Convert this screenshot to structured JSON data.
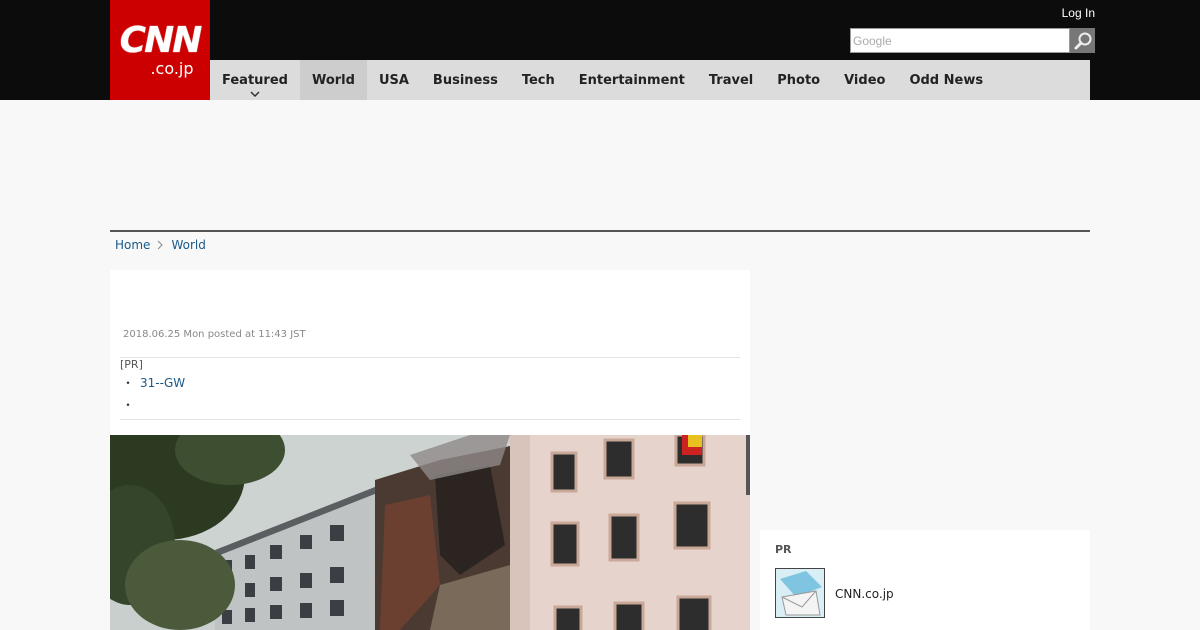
{
  "header": {
    "logo_main": "CNN",
    "logo_sub": ".co.jp",
    "login_label": "Log In",
    "search_placeholder": "Google"
  },
  "nav": {
    "items": [
      {
        "label": "Featured"
      },
      {
        "label": "World"
      },
      {
        "label": "USA"
      },
      {
        "label": "Business"
      },
      {
        "label": "Tech"
      },
      {
        "label": "Entertainment"
      },
      {
        "label": "Travel"
      },
      {
        "label": "Photo"
      },
      {
        "label": "Video"
      },
      {
        "label": "Odd News"
      }
    ],
    "active": "World"
  },
  "breadcrumb": {
    "home": "Home",
    "section": "World"
  },
  "article": {
    "posted": "2018.06.25 Mon posted at 11:43 JST",
    "pr_label": "[PR]",
    "pr_bullet": "・",
    "pr_link": "31--GW",
    "pr_bullet2": "・"
  },
  "sidebar": {
    "pr_label": "PR",
    "pr_text": "CNN.co.jp"
  },
  "colors": {
    "brand_red": "#cc0000",
    "topbar": "#0c0c0c",
    "nav_bg": "#dcdcdc",
    "link": "#1a5a8a"
  }
}
